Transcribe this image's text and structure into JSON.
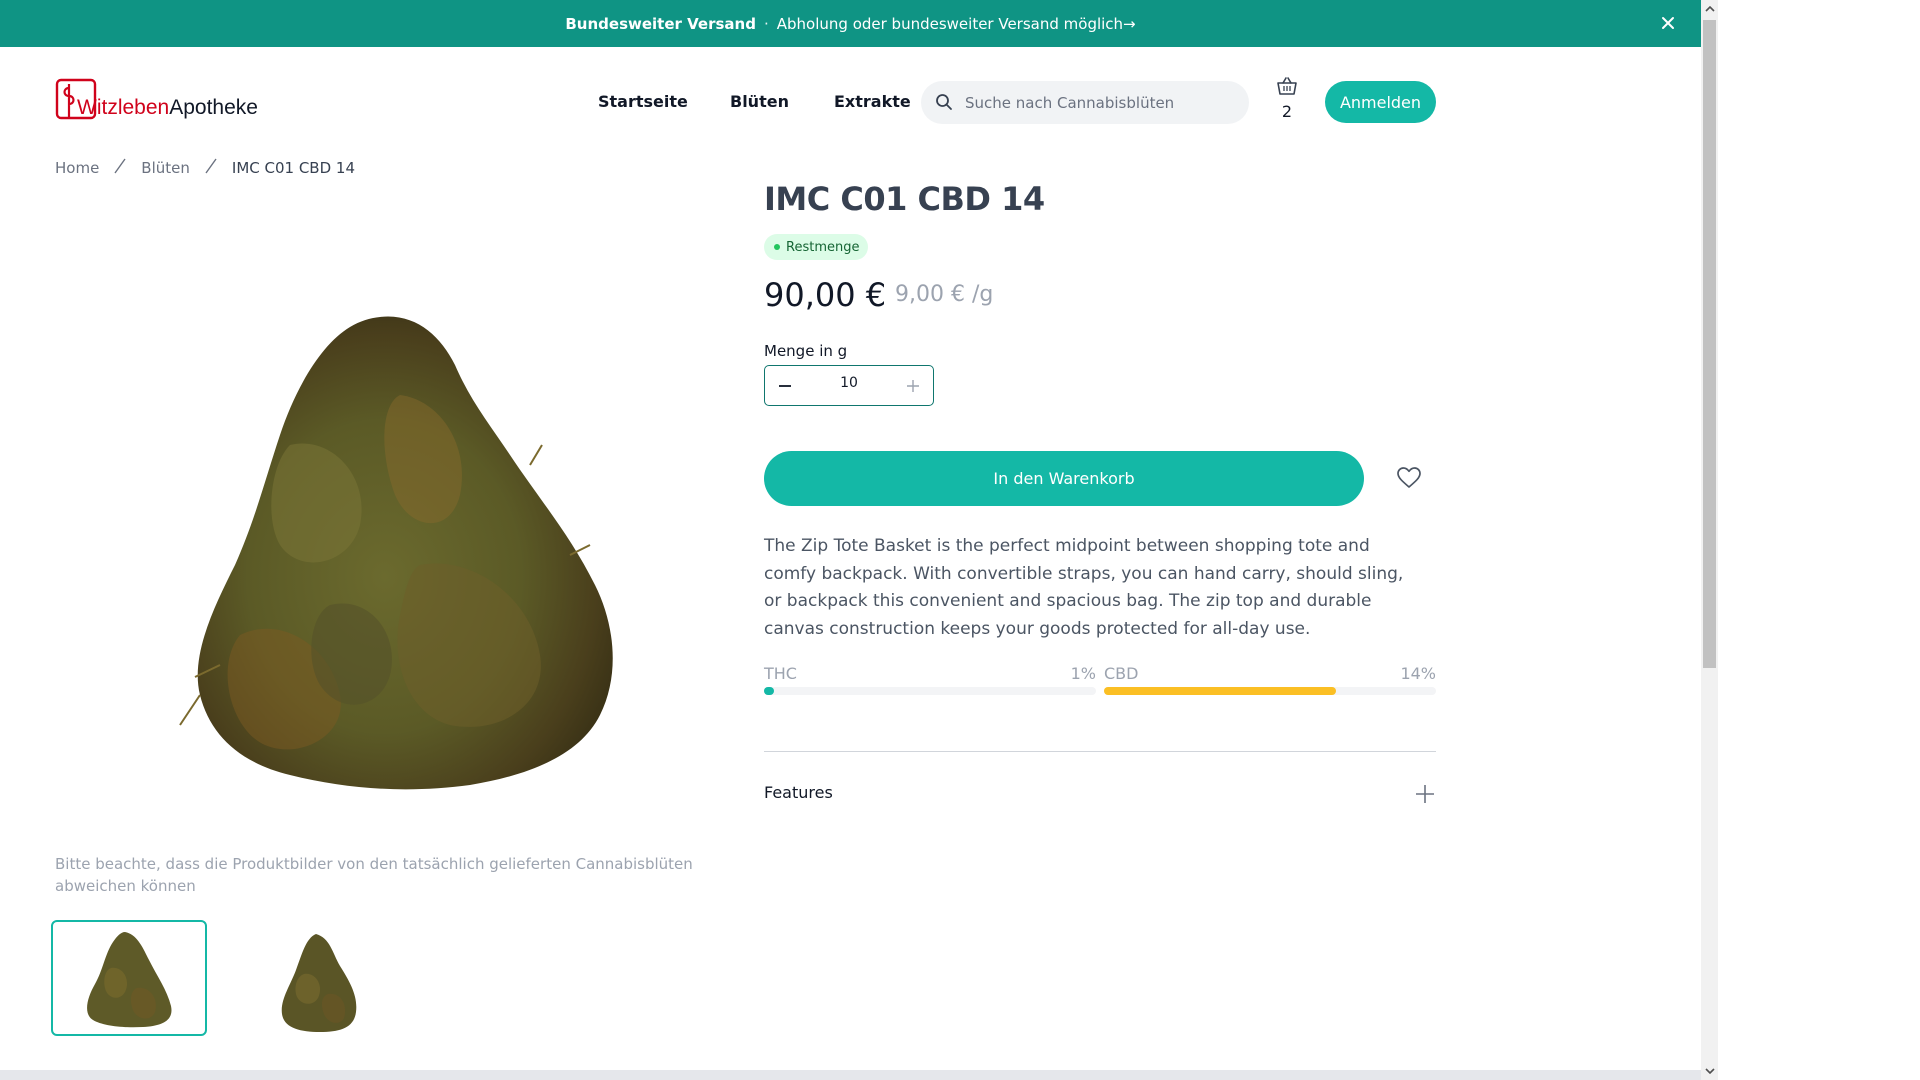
{
  "announcement": {
    "title": "Bundesweiter Versand",
    "separator": "·",
    "message": "Abholung oder bundesweiter Versand möglich→"
  },
  "brand": {
    "name_red": "Witzleben",
    "name_dark": "Apotheke",
    "color": "#d0021b",
    "accent": "#14b8a6"
  },
  "nav": {
    "items": [
      "Startseite",
      "Blüten",
      "Extrakte"
    ]
  },
  "search": {
    "placeholder": "Suche nach Cannabisblüten"
  },
  "cart": {
    "count": "2"
  },
  "login_label": "Anmelden",
  "breadcrumb": {
    "items": [
      "Home",
      "Blüten",
      "IMC C01 CBD 14"
    ]
  },
  "product": {
    "title": "IMC C01 CBD 14",
    "badge": "Restmenge",
    "price": "90,00 €",
    "unit_price": "9,00 € /g",
    "quantity_label": "Menge in g",
    "quantity": "10",
    "add_to_cart": "In den Warenkorb",
    "description": "The Zip Tote Basket is the perfect midpoint between shopping tote and comfy backpack. With convertible straps, you can hand carry, should sling, or backpack this convenient and spacious bag. The zip top and durable canvas construction keeps your goods protected for all-day use.",
    "note": "Bitte beachte, dass die Produktbilder von den tatsächlich gelieferten Cannabisblüten abweichen können",
    "features_label": "Features"
  },
  "potency": [
    {
      "name": "THC",
      "value_text": "1%",
      "fraction": 0.01,
      "color": "#14b8a6"
    },
    {
      "name": "CBD",
      "value_text": "14%",
      "fraction": 0.7,
      "color": "#fbbf24"
    }
  ]
}
